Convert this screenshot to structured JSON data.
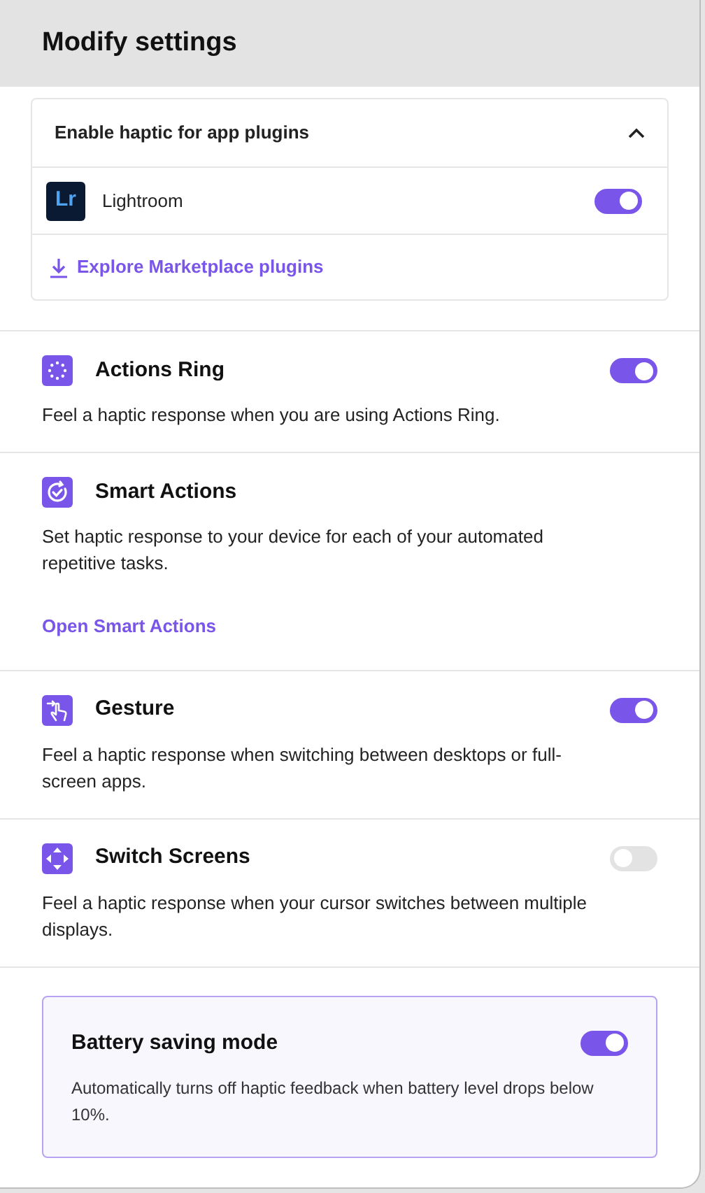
{
  "header": {
    "title": "Modify settings"
  },
  "plugins": {
    "title": "Enable haptic for app plugins",
    "expanded": true,
    "items": [
      {
        "badge": "Lr",
        "name": "Lightroom",
        "on": true
      }
    ],
    "link": "Explore Marketplace plugins"
  },
  "sections": [
    {
      "kind": "ring",
      "title": "Actions Ring",
      "on": true,
      "description": "Feel a haptic response when you are using Actions Ring."
    },
    {
      "kind": "smart",
      "title": "Smart Actions",
      "description": "Set haptic response to your device for each of your automated repetitive tasks.",
      "link": "Open Smart Actions"
    },
    {
      "kind": "gesture",
      "title": "Gesture",
      "on": true,
      "description": "Feel a haptic response when switching between desktops or full-screen apps."
    },
    {
      "kind": "screens",
      "title": "Switch Screens",
      "on": false,
      "description": "Feel a haptic response when your cursor switches between multiple displays."
    }
  ],
  "battery": {
    "title": "Battery saving mode",
    "on": true,
    "description": "Automatically turns off haptic feedback when battery level drops below 10%."
  }
}
